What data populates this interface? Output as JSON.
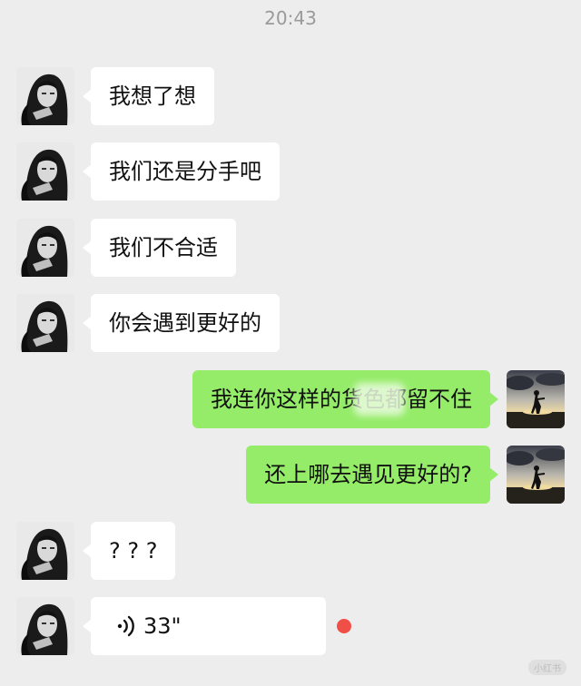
{
  "chat": {
    "timestamp": "20:43",
    "messages": [
      {
        "side": "in",
        "text": "我想了想"
      },
      {
        "side": "in",
        "text": "我们还是分手吧"
      },
      {
        "side": "in",
        "text": "我们不合适"
      },
      {
        "side": "in",
        "text": "你会遇到更好的"
      },
      {
        "side": "out",
        "text": "我连你这样的货色都留不住"
      },
      {
        "side": "out",
        "text": "还上哪去遇见更好的?"
      },
      {
        "side": "in",
        "text": "? ? ?"
      },
      {
        "side": "in",
        "type": "voice",
        "duration": "33\""
      }
    ]
  },
  "watermark": "小红书",
  "colors": {
    "background": "#ededed",
    "incoming_bubble": "#ffffff",
    "outgoing_bubble": "#95ec69",
    "unread_dot": "#f04f48",
    "timestamp_text": "#9a9a9a"
  },
  "icons": {
    "contact_avatar": "anime-character-avatar",
    "self_avatar": "sunset-silhouette-avatar",
    "voice": "voice-wave-icon"
  }
}
